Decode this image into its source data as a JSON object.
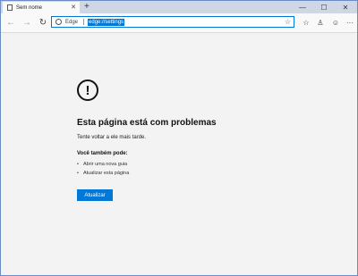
{
  "tab": {
    "title": "Sem nome",
    "close": "✕",
    "new_tab": "+"
  },
  "window_controls": {
    "minimize": "—",
    "maximize": "☐",
    "close": "✕"
  },
  "toolbar": {
    "back": "←",
    "forward": "→",
    "refresh": "↻",
    "browser_label": "Edge",
    "url": "edge://settings",
    "star": "☆",
    "favorites": "☆",
    "profile": "♙",
    "emoji": "☺",
    "more": "···"
  },
  "error_page": {
    "icon": "!",
    "heading": "Esta página está com problemas",
    "subtext": "Tente voltar a ele mais tarde.",
    "also_heading": "Você também pode:",
    "options": [
      "Abrir uma nova guia",
      "Atualizar esta página"
    ],
    "refresh_button": "Atualizar"
  },
  "colors": {
    "accent": "#0078d7",
    "page_bg": "#f3f3f3",
    "titlebar": "#cfd6e6"
  }
}
